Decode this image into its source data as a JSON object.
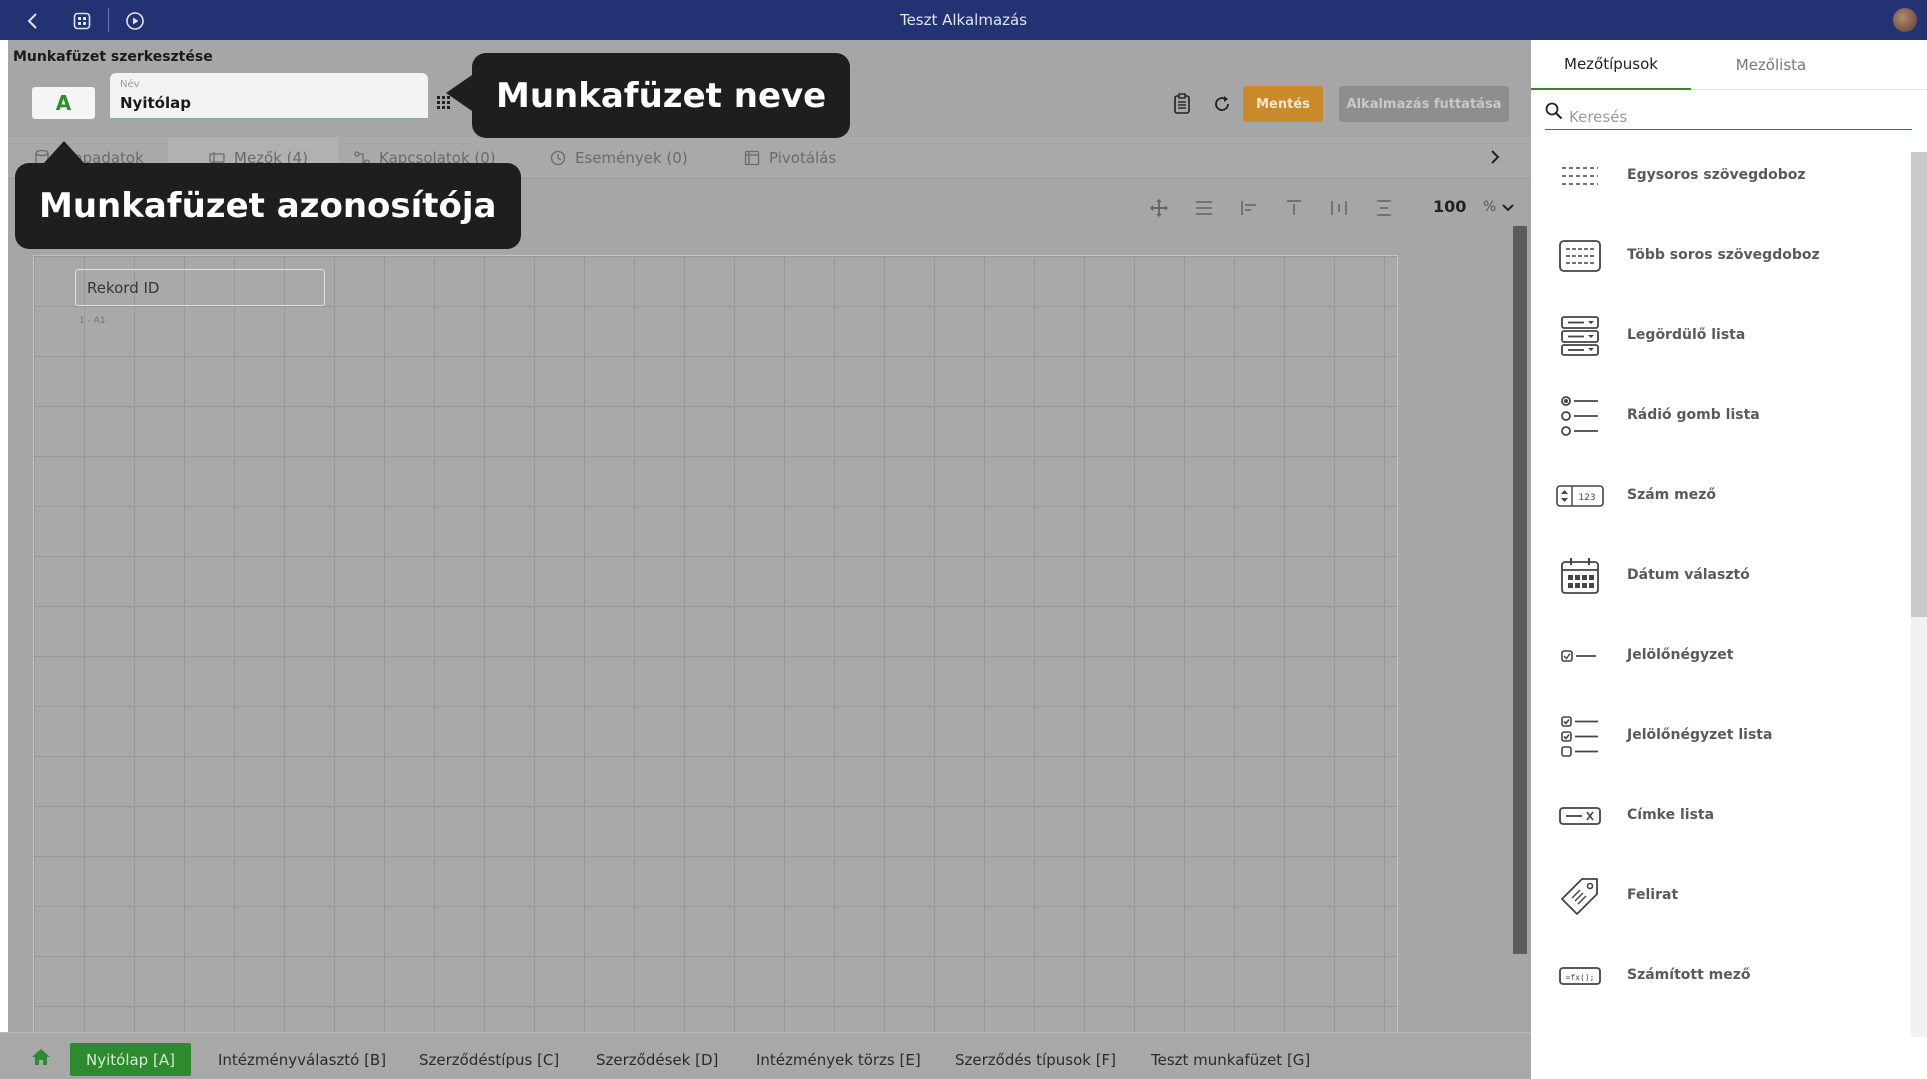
{
  "app": {
    "title": "Teszt Alkalmazás"
  },
  "editor": {
    "heading": "Munkafüzet szerkesztése",
    "sheet_id": "A",
    "name_label": "Név",
    "name_value": "Nyitólap",
    "save_label": "Mentés",
    "run_label": "Alkalmazás futtatása",
    "tabs": [
      {
        "label": "Alapadatok",
        "icon": "database-icon"
      },
      {
        "label": "Mezők (4)",
        "icon": "fields-icon"
      },
      {
        "label": "Kapcsolatok (0)",
        "icon": "connections-icon"
      },
      {
        "label": "Események (0)",
        "icon": "events-icon"
      },
      {
        "label": "Pivotálás",
        "icon": "pivot-icon"
      }
    ],
    "zoom_value": "100",
    "zoom_unit": "%",
    "canvas_fields": [
      {
        "label": "Rekord ID",
        "ref": "1 - A1"
      }
    ]
  },
  "callouts": {
    "name": "Munkafüzet neve",
    "id": "Munkafüzet azonosítója"
  },
  "bottom_tabs": [
    "Nyitólap [A]",
    "Intézményválasztó [B]",
    "Szerződéstípus [C]",
    "Szerződések [D]",
    "Intézmények törzs [E]",
    "Szerződés típusok [F]",
    "Teszt munkafüzet [G]"
  ],
  "right_panel": {
    "tabs": [
      "Mezőtípusok",
      "Mezőlista"
    ],
    "active_tab": "Mezőtípusok",
    "search_placeholder": "Keresés",
    "field_types": [
      {
        "label": "Egysoros szövegdoboz",
        "icon": "single-line-text-icon"
      },
      {
        "label": "Több soros szövegdoboz",
        "icon": "multi-line-text-icon"
      },
      {
        "label": "Legördülő lista",
        "icon": "dropdown-list-icon"
      },
      {
        "label": "Rádió gomb lista",
        "icon": "radio-list-icon"
      },
      {
        "label": "Szám mező",
        "icon": "number-field-icon"
      },
      {
        "label": "Dátum választó",
        "icon": "date-picker-icon"
      },
      {
        "label": "Jelölőnégyzet",
        "icon": "checkbox-icon"
      },
      {
        "label": "Jelölőnégyzet lista",
        "icon": "checkbox-list-icon"
      },
      {
        "label": "Címke lista",
        "icon": "tag-list-icon"
      },
      {
        "label": "Felirat",
        "icon": "label-tag-icon"
      },
      {
        "label": "Számított mező",
        "icon": "calculated-field-icon"
      }
    ]
  },
  "colors": {
    "topbar": "#223273",
    "accent_green": "#2e8a2e",
    "save_orange": "#c88a2a"
  }
}
